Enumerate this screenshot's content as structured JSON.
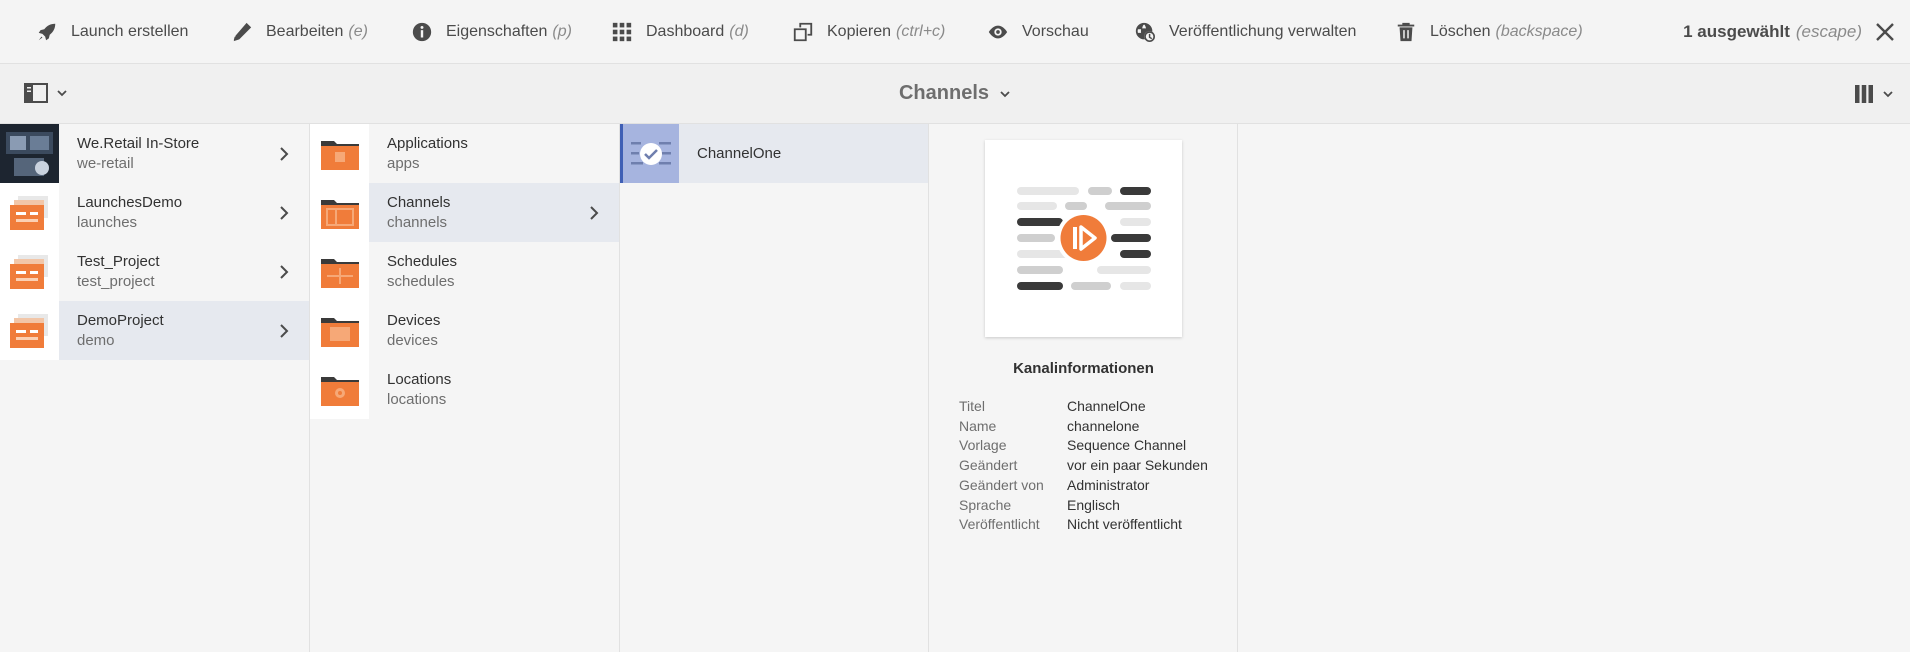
{
  "actionbar": {
    "launch": {
      "label": "Launch erstellen",
      "shortcut": ""
    },
    "edit": {
      "label": "Bearbeiten",
      "shortcut": "(e)"
    },
    "properties": {
      "label": "Eigenschaften",
      "shortcut": "(p)"
    },
    "dashboard": {
      "label": "Dashboard",
      "shortcut": "(d)"
    },
    "copy": {
      "label": "Kopieren",
      "shortcut": "(ctrl+c)"
    },
    "preview": {
      "label": "Vorschau",
      "shortcut": ""
    },
    "publish": {
      "label": "Veröffentlichung verwalten",
      "shortcut": ""
    },
    "delete": {
      "label": "Löschen",
      "shortcut": "(backspace)"
    },
    "selection": {
      "label": "1 ausgewählt",
      "shortcut": "(escape)"
    }
  },
  "titlebar": {
    "title": "Channels"
  },
  "columns": {
    "projects": [
      {
        "title": "We.Retail In-Store",
        "subtitle": "we-retail"
      },
      {
        "title": "LaunchesDemo",
        "subtitle": "launches"
      },
      {
        "title": "Test_Project",
        "subtitle": "test_project"
      },
      {
        "title": "DemoProject",
        "subtitle": "demo"
      }
    ],
    "folders": [
      {
        "title": "Applications",
        "subtitle": "apps"
      },
      {
        "title": "Channels",
        "subtitle": "channels"
      },
      {
        "title": "Schedules",
        "subtitle": "schedules"
      },
      {
        "title": "Devices",
        "subtitle": "devices"
      },
      {
        "title": "Locations",
        "subtitle": "locations"
      }
    ],
    "channels": [
      {
        "title": "ChannelOne"
      }
    ]
  },
  "preview": {
    "heading": "Kanalinformationen",
    "meta": [
      {
        "key": "Titel",
        "value": "ChannelOne"
      },
      {
        "key": "Name",
        "value": "channelone"
      },
      {
        "key": "Vorlage",
        "value": "Sequence Channel"
      },
      {
        "key": "Geändert",
        "value": "vor ein paar Sekunden"
      },
      {
        "key": "Geändert von",
        "value": "Administrator"
      },
      {
        "key": "Sprache",
        "value": "Englisch"
      },
      {
        "key": "Veröffentlicht",
        "value": "Nicht veröffentlicht"
      }
    ]
  },
  "colors": {
    "accent": "#f07c3a",
    "selection": "#a6b4df",
    "active_row": "#e6e9ef"
  }
}
